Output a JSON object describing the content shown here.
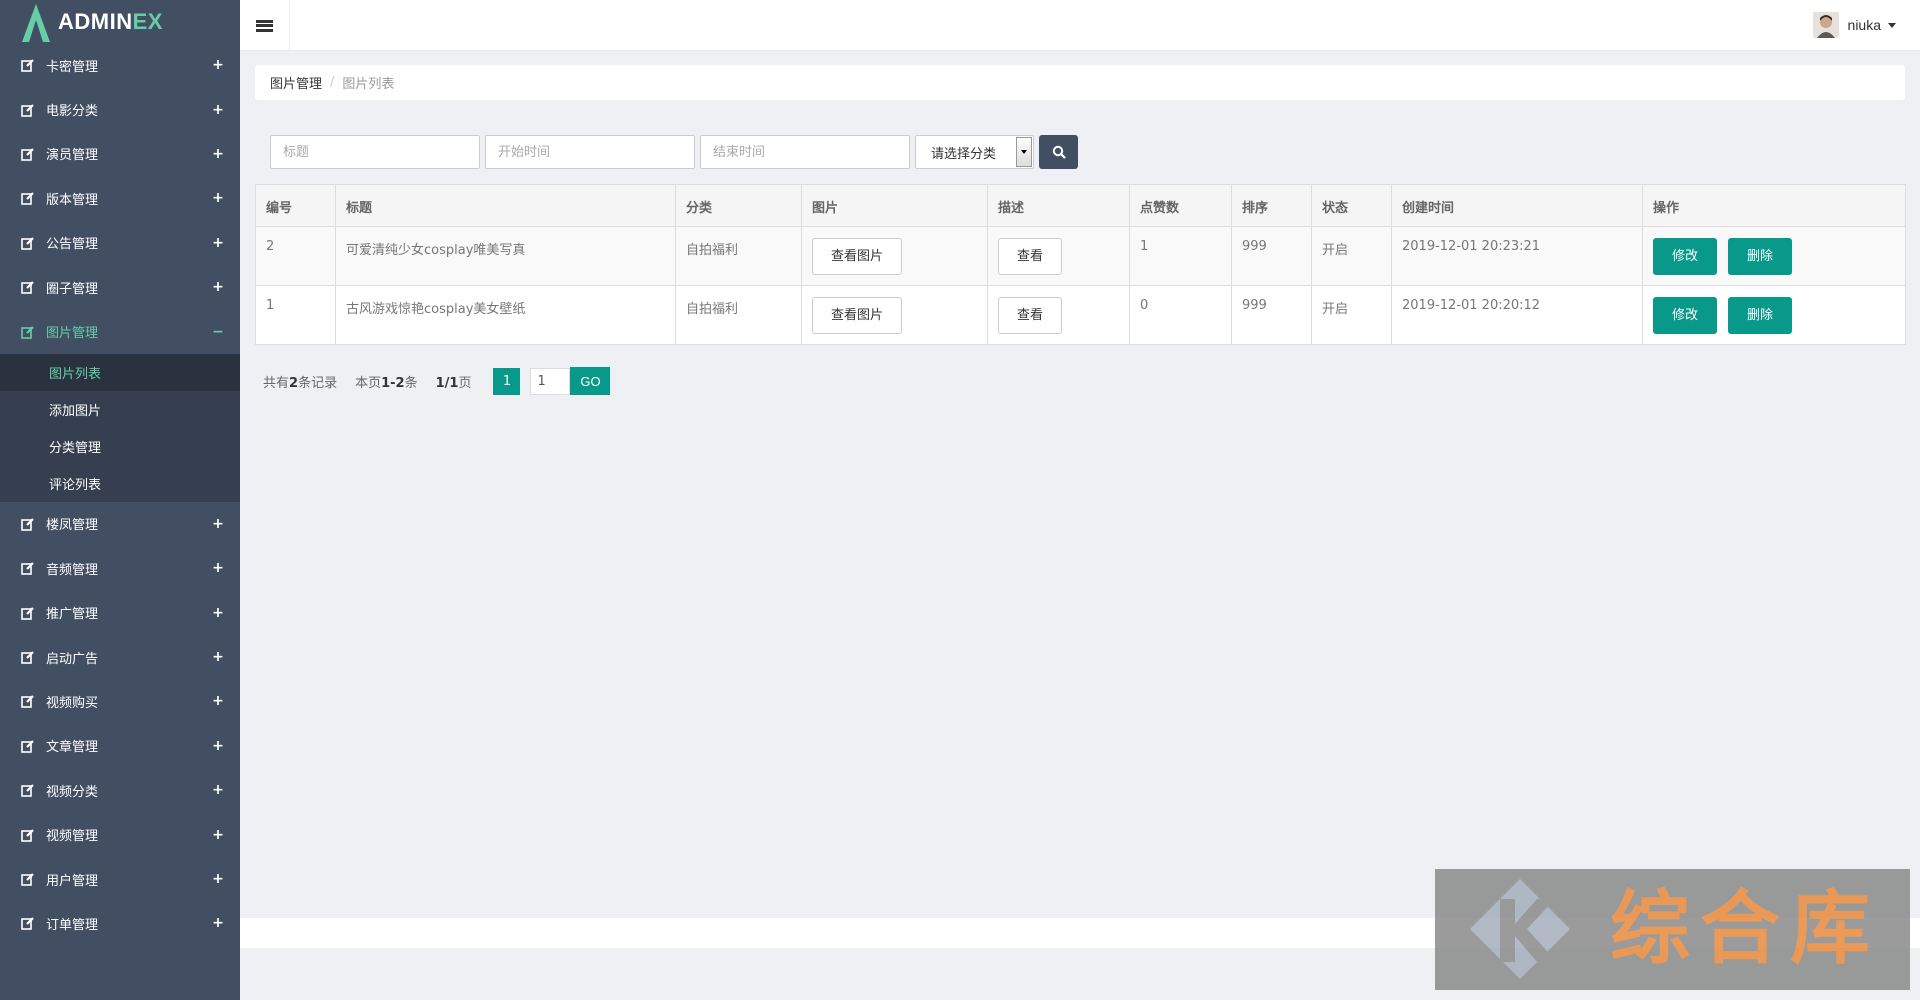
{
  "brand": {
    "name_main": "ADMIN",
    "name_accent": "EX"
  },
  "sidebar": {
    "items_top": [
      {
        "label": "卡密管理",
        "toggle": "+"
      },
      {
        "label": "电影分类",
        "toggle": "+"
      },
      {
        "label": "演员管理",
        "toggle": "+"
      },
      {
        "label": "版本管理",
        "toggle": "+"
      },
      {
        "label": "公告管理",
        "toggle": "+"
      },
      {
        "label": "圈子管理",
        "toggle": "+"
      },
      {
        "label": "图片管理",
        "toggle": "−"
      }
    ],
    "subitems": [
      {
        "label": "图片列表"
      },
      {
        "label": "添加图片"
      },
      {
        "label": "分类管理"
      },
      {
        "label": "评论列表"
      }
    ],
    "items_bottom": [
      {
        "label": "楼凤管理",
        "toggle": "+"
      },
      {
        "label": "音频管理",
        "toggle": "+"
      },
      {
        "label": "推广管理",
        "toggle": "+"
      },
      {
        "label": "启动广告",
        "toggle": "+"
      },
      {
        "label": "视频购买",
        "toggle": "+"
      },
      {
        "label": "文章管理",
        "toggle": "+"
      },
      {
        "label": "视频分类",
        "toggle": "+"
      },
      {
        "label": "视频管理",
        "toggle": "+"
      },
      {
        "label": "用户管理",
        "toggle": "+"
      },
      {
        "label": "订单管理",
        "toggle": "+"
      }
    ]
  },
  "header": {
    "username": "niuka"
  },
  "breadcrumb": {
    "parent": "图片管理",
    "separator": "/",
    "current": "图片列表"
  },
  "filters": {
    "title_placeholder": "标题",
    "start_placeholder": "开始时间",
    "end_placeholder": "结束时间",
    "category_selected": "请选择分类"
  },
  "table": {
    "headers": [
      "编号",
      "标题",
      "分类",
      "图片",
      "描述",
      "点赞数",
      "排序",
      "状态",
      "创建时间",
      "操作"
    ],
    "rows": [
      {
        "id": "2",
        "title": "可爱清纯少女cosplay唯美写真",
        "category": "自拍福利",
        "image_btn": "查看图片",
        "desc_btn": "查看",
        "likes": "1",
        "sort": "999",
        "status": "开启",
        "created": "2019-12-01 20:23:21",
        "edit_btn": "修改",
        "delete_btn": "删除"
      },
      {
        "id": "1",
        "title": "古风游戏惊艳cosplay美女壁纸",
        "category": "自拍福利",
        "image_btn": "查看图片",
        "desc_btn": "查看",
        "likes": "0",
        "sort": "999",
        "status": "开启",
        "created": "2019-12-01 20:20:12",
        "edit_btn": "修改",
        "delete_btn": "删除"
      }
    ]
  },
  "pager": {
    "total_prefix": "共有",
    "total": "2",
    "total_suffix": "条记录",
    "range_prefix": "本页",
    "range": "1-2",
    "range_suffix": "条",
    "pages": "1/1",
    "pages_suffix": "页",
    "current_page": "1",
    "input_value": "1",
    "go_label": "GO"
  },
  "watermark": {
    "text": "综合库"
  },
  "colors": {
    "sidebar": "#424f63",
    "accent": "#65cea7",
    "primary_button": "#09998a"
  }
}
